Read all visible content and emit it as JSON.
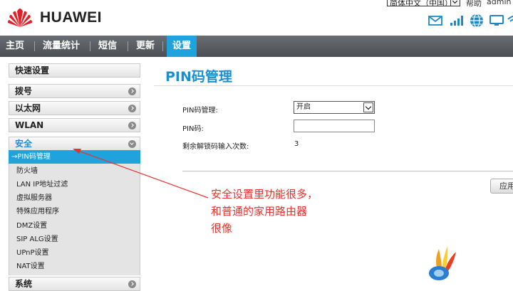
{
  "header": {
    "brand": "HUAWEI",
    "language_select": "简体中文（中国）",
    "help": "帮助",
    "user": "admin",
    "icons": [
      "sms-icon",
      "signal-icon",
      "internet-icon",
      "monitor-icon",
      "wifi-icon"
    ]
  },
  "nav": {
    "items": [
      "主页",
      "流量统计",
      "短信",
      "更新",
      "设置"
    ],
    "active": "设置"
  },
  "sidebar": {
    "quick_setup": "快速设置",
    "dialup": "拨号",
    "ethernet": "以太网",
    "wlan": "WLAN",
    "security": "安全",
    "security_items": [
      "→PIN码管理",
      "防火墙",
      "LAN IP地址过滤",
      "虚拟服务器",
      "特殊应用程序",
      "DMZ设置",
      "SIP ALG设置",
      "UPnP设置",
      "NAT设置"
    ],
    "system": "系统"
  },
  "content": {
    "title": "PIN码管理",
    "pin_management_label": "PIN码管理:",
    "pin_management_value": "开启",
    "pin_label": "PIN码:",
    "pin_value": "",
    "attempts_label": "剩余解锁码输入次数:",
    "attempts_value": "3",
    "apply_button": "应用"
  },
  "annotation": {
    "text": "安全设置里功能很多，\n和普通的家用路由器\n很像"
  },
  "colors": {
    "accent": "#20a3dc",
    "title_blue": "#1a8fd0",
    "annotation_red": "#e8322d",
    "nav_bg": "#5a5e62"
  }
}
